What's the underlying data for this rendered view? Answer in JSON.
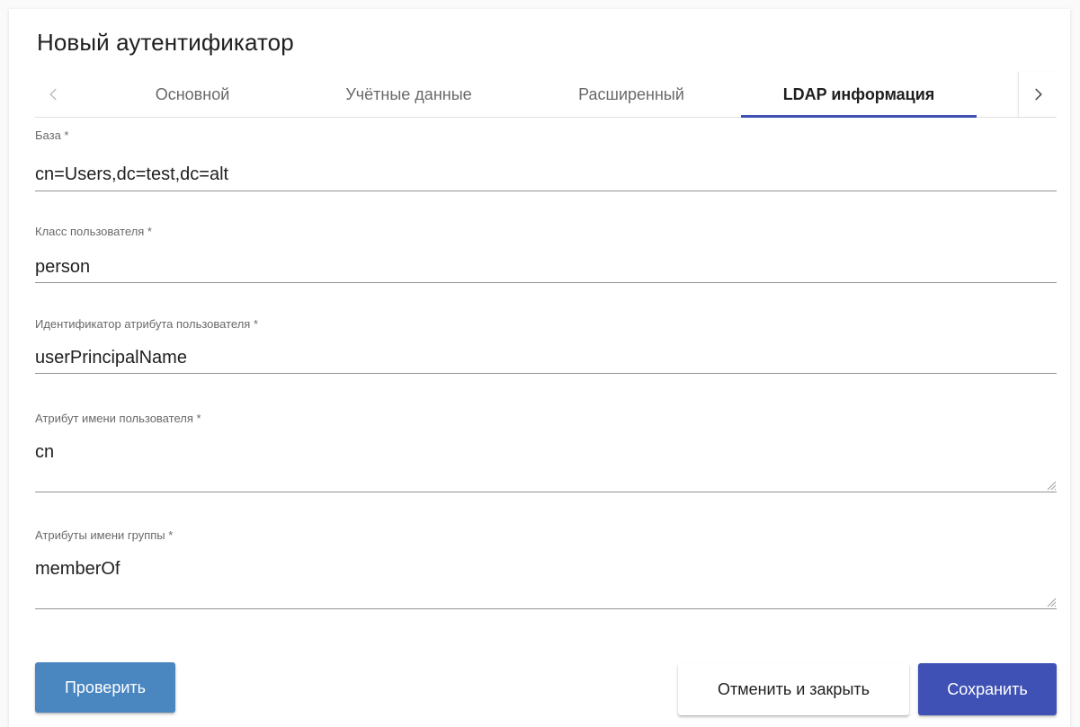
{
  "dialog": {
    "title": "Новый аутентификатор"
  },
  "tabs": {
    "items": [
      {
        "label": "Основной",
        "active": false
      },
      {
        "label": "Учётные данные",
        "active": false
      },
      {
        "label": "Расширенный",
        "active": false
      },
      {
        "label": "LDAP информация",
        "active": true
      }
    ],
    "prev_icon": "chevron-left-icon",
    "next_icon": "chevron-right-icon"
  },
  "fields": {
    "base": {
      "label": "База *",
      "value": "cn=Users,dc=test,dc=alt"
    },
    "user_class": {
      "label": "Класс пользователя *",
      "value": "person"
    },
    "user_id_attr": {
      "label": "Идентификатор атрибута пользователя *",
      "value": "userPrincipalName"
    },
    "user_name_attr": {
      "label": "Атрибут имени пользователя *",
      "value": "cn"
    },
    "group_name_attrs": {
      "label": "Атрибуты имени группы *",
      "value": "memberOf"
    }
  },
  "buttons": {
    "test_label": "Проверить",
    "cancel_label": "Отменить и закрыть",
    "save_label": "Сохранить"
  },
  "colors": {
    "accent": "#3f51b5",
    "test_button": "#4a86c0"
  }
}
